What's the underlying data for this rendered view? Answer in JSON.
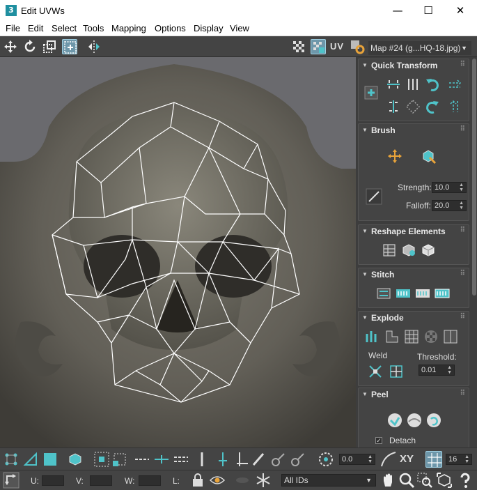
{
  "window": {
    "title": "Edit UVWs",
    "app_icon_label": "3",
    "minimize": "—",
    "maximize": "☐",
    "close": "✕"
  },
  "menu": [
    "File",
    "Edit",
    "Select",
    "Tools",
    "Mapping",
    "Options",
    "Display",
    "View"
  ],
  "toolbar": {
    "uv_label": "UV",
    "map_dropdown": "Map #24 (g...HQ-18.jpg)"
  },
  "panel": {
    "quick_transform": {
      "title": "Quick Transform"
    },
    "brush": {
      "title": "Brush",
      "strength_label": "Strength:",
      "strength_value": "10.0",
      "falloff_label": "Falloff:",
      "falloff_value": "20.0"
    },
    "reshape": {
      "title": "Reshape Elements"
    },
    "stitch": {
      "title": "Stitch"
    },
    "explode": {
      "title": "Explode",
      "weld_label": "Weld",
      "threshold_label": "Threshold:",
      "threshold_value": "0.01"
    },
    "peel": {
      "title": "Peel",
      "detach_label": "Detach",
      "detach_checked": true
    }
  },
  "bottom1": {
    "offset_value": "0.0",
    "xy_label": "XY",
    "grid_value": "16"
  },
  "bottom2": {
    "u_label": "U:",
    "v_label": "V:",
    "w_label": "W:",
    "l_label": "L:",
    "ids_dropdown": "All IDs"
  },
  "colors": {
    "accent": "#4fc3c9",
    "panel_bg": "#444444",
    "viewport_bg": "#58585a",
    "wire": "#ffffff"
  }
}
